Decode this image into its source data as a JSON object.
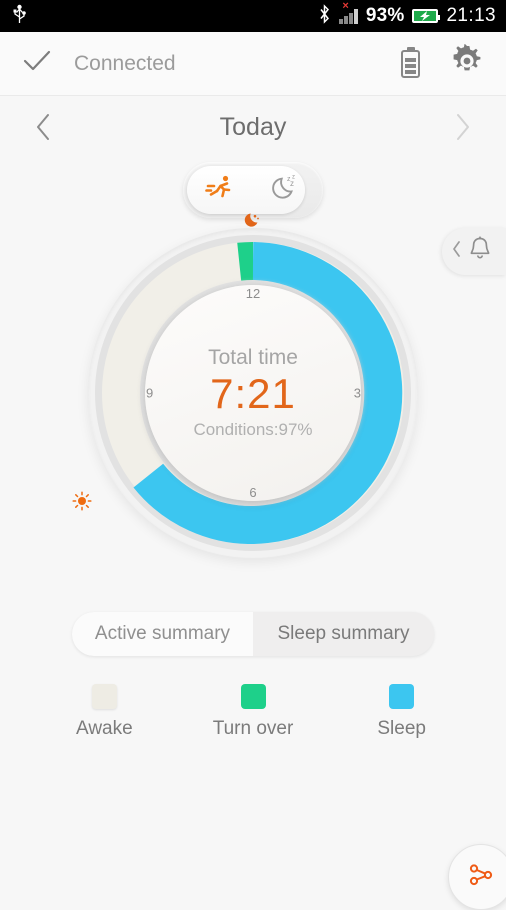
{
  "status_bar": {
    "usb_icon": "usb-icon",
    "bluetooth_icon": "bluetooth-icon",
    "signal_icon": "signal-bars-icon",
    "signal_error": "×",
    "battery_percent": "93%",
    "battery_icon": "battery-charging-icon",
    "time": "21:13"
  },
  "app_bar": {
    "check_icon": "check-icon",
    "title": "Connected",
    "battery_icon": "device-battery-icon",
    "settings_icon": "gear-icon"
  },
  "date_nav": {
    "prev_icon": "chevron-left-icon",
    "label": "Today",
    "next_icon": "chevron-right-icon"
  },
  "mode_toggle": {
    "active_icon": "running-person-icon",
    "sleep_icon": "moon-zzz-icon",
    "selected": "active"
  },
  "alarm_drawer": {
    "chevron_icon": "chevron-left-icon",
    "bell_icon": "bell-icon"
  },
  "ring": {
    "bedtime_icon": "moon-icon",
    "wakeup_icon": "sun-icon",
    "center_label": "Total time",
    "center_value": "7:21",
    "center_sub": "Conditions:97%",
    "hour_marks": [
      "12",
      "3",
      "6",
      "9"
    ]
  },
  "summary_tabs": {
    "active_label": "Active summary",
    "sleep_label": "Sleep summary",
    "selected": "Sleep summary"
  },
  "legend": [
    {
      "label": "Awake",
      "color": "#eeece4"
    },
    {
      "label": "Turn over",
      "color": "#1ed08a"
    },
    {
      "label": "Sleep",
      "color": "#3cc6f0"
    }
  ],
  "share_button": {
    "icon": "share-icon"
  },
  "colors": {
    "accent_orange": "#e2661a",
    "sleep_blue": "#3cc6f0",
    "turnover_green": "#1ed08a",
    "awake_cream": "#eeece4",
    "page_bg": "#f7f7f7"
  },
  "chart_data": {
    "type": "pie",
    "title": "Total time",
    "categories": [
      "Awake",
      "Turn over",
      "Sleep"
    ],
    "values": [
      34,
      3,
      63
    ],
    "unit": "percent of ring",
    "series": [
      {
        "name": "Awake",
        "start_deg": 232,
        "end_deg": 352,
        "color": "#eeece4"
      },
      {
        "name": "Turn over",
        "start_deg": 352,
        "end_deg": 364,
        "color": "#1ed08a"
      },
      {
        "name": "Sleep",
        "start_deg": 364,
        "end_deg": 592,
        "color": "#3cc6f0"
      }
    ],
    "center_value": "7:21",
    "center_label": "Total time",
    "annotation": "Conditions:97%",
    "axis_ticks": [
      "12",
      "3",
      "6",
      "9"
    ],
    "legend_position": "bottom",
    "grid": false
  }
}
